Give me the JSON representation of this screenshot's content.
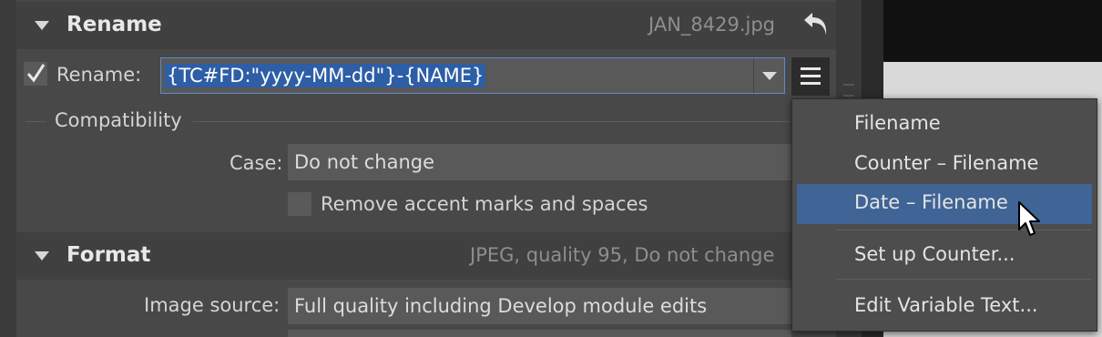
{
  "rename": {
    "title": "Rename",
    "filename": "JAN_8429.jpg",
    "checkbox_checked": true,
    "label": "Rename:",
    "value": "{TC#FD:\"yyyy-MM-dd\"}-{NAME}"
  },
  "compatibility": {
    "title": "Compatibility",
    "case_label": "Case:",
    "case_value": "Do not change",
    "remove_accents_label": "Remove accent marks and spaces",
    "remove_accents_checked": false
  },
  "format": {
    "title": "Format",
    "summary": "JPEG, quality 95, Do not change",
    "image_source_label": "Image source:",
    "image_source_value": "Full quality including Develop module edits"
  },
  "menu": {
    "items": [
      {
        "label": "Filename"
      },
      {
        "label": "Counter – Filename"
      },
      {
        "label": "Date – Filename",
        "highlighted": true
      },
      {
        "label": "Set up Counter..."
      },
      {
        "label": "Edit Variable Text..."
      }
    ]
  },
  "colors": {
    "panel_bg": "#484848",
    "header_bg": "#404040",
    "selection": "#2d5ea6",
    "menu_highlight": "#3f6495"
  },
  "icons": [
    "collapse-triangle-icon",
    "undo-arrow-icon",
    "checkmark-icon",
    "dropdown-arrow-icon",
    "hamburger-menu-icon",
    "mouse-cursor-icon"
  ]
}
